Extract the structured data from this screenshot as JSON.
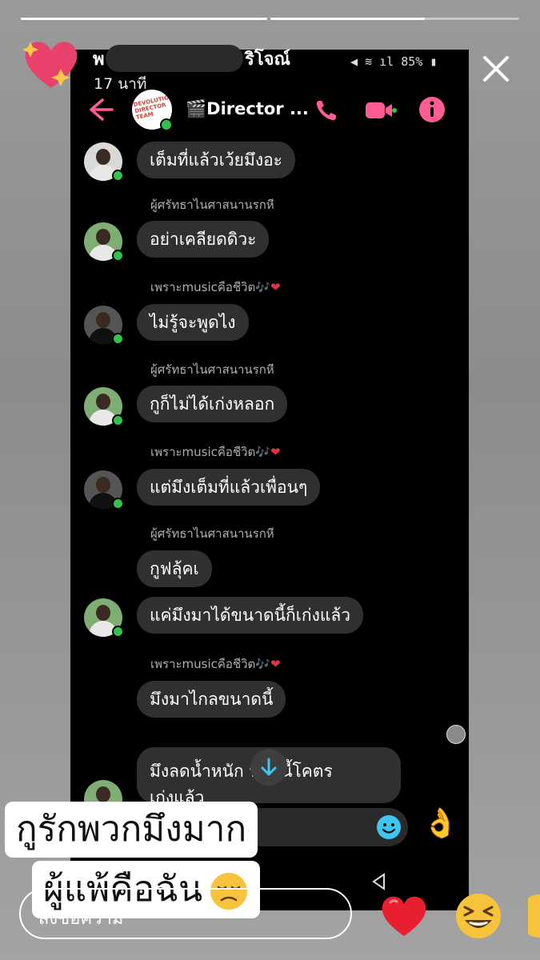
{
  "story": {
    "name_visible": "พ",
    "name_suffix": "ริโจณ์",
    "time": "17 นาที",
    "progress": [
      1.0,
      0.6
    ]
  },
  "status_bar": {
    "battery": "85%"
  },
  "messenger": {
    "group_name": "🎬Director ...",
    "group_avatar_text": "DEVOLUTION\nDIRECTOR\nTEAM"
  },
  "messages": [
    {
      "sender": "",
      "text": "เต็มที่แล้วเว้ยมึงอะ"
    },
    {
      "sender": "ผู้ศรัทธาไนศาสนานรกหี",
      "text": "อย่าเคลียดดิวะ"
    },
    {
      "sender": "เพราะmusicคือชีวิต🎶",
      "text": "ไม่รู้จะพูดไง"
    },
    {
      "sender": "ผู้ศรัทธาไนศาสนานรกหี",
      "text": "กูก็ไม่ได้เก่งหลอก"
    },
    {
      "sender": "เพราะmusicคือชีวิต🎶",
      "text": "แต่มึงเต็มที่แล้วเพื่อนๆ"
    },
    {
      "sender": "ผู้ศรัทธาไนศาสนานรกหี",
      "text": "กูฟลุ้คเ"
    },
    {
      "sender": "",
      "text": "แค่มึงมาได้ขนาดนี้ก็เก่งแล้ว"
    },
    {
      "sender": "เพราะmusicคือชีวิต🎶",
      "text": "มึงมาไกลขนาดนี้"
    },
    {
      "sender": "",
      "text": "มึงลดน้ำหนัก     นาดนี้โคตร",
      "text2": "เก่งแล้ว"
    }
  ],
  "heart": "❤",
  "overlay": {
    "line1": "กูรักพวกมึงมาก",
    "line2": "ผู้แพ้คือฉัน"
  },
  "reply": {
    "placeholder": "ส่งข้อความ"
  },
  "reactions": [
    "heart",
    "laughing",
    "partial"
  ],
  "icons": {
    "close": "close-icon",
    "back": "back-arrow-icon",
    "phone": "phone-icon",
    "video": "video-camera-icon",
    "info": "info-icon",
    "scroll": "arrow-down-icon",
    "smile": "smile-icon",
    "ok": "ok-hand-emoji"
  },
  "colors": {
    "accent": "#ff5d92",
    "online": "#31c24e",
    "bubble": "#303030"
  }
}
